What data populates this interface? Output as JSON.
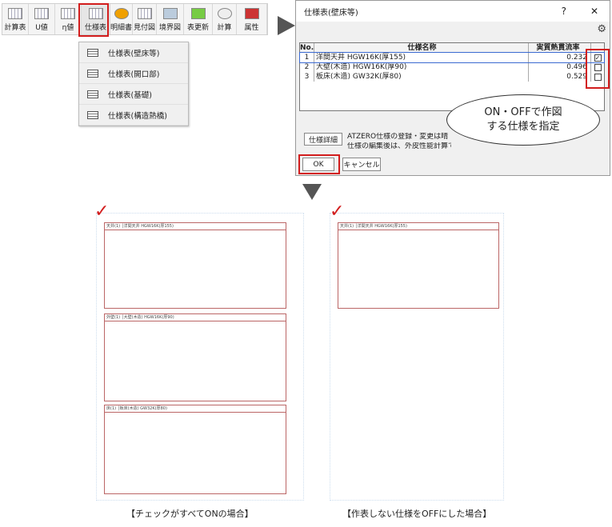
{
  "ribbon": {
    "items": [
      "計算表",
      "U値",
      "η値",
      "仕様表",
      "明細書",
      "見付図",
      "境界図",
      "表更新",
      "計算",
      "属性"
    ]
  },
  "menu": {
    "items": [
      "仕様表(壁床等)",
      "仕様表(開口部)",
      "仕様表(基礎)",
      "仕様表(構造熱橋)"
    ]
  },
  "dialog": {
    "title": "仕様表(壁床等)",
    "help": "?",
    "close": "✕",
    "headers": {
      "no": "No.",
      "name": "仕様名称",
      "value": "実質熱貫流率"
    },
    "rows": [
      {
        "no": "1",
        "name": "洋間天井 HGW16K(厚155)",
        "value": "0.232",
        "checked": true
      },
      {
        "no": "2",
        "name": "大壁(木造) HGW16K(厚90)",
        "value": "0.496",
        "checked": false
      },
      {
        "no": "3",
        "name": "板床(木造) GW32K(厚80)",
        "value": "0.529",
        "checked": false
      }
    ],
    "spec_detail": "仕様詳細",
    "note1": "ATZERO仕様の登録・変更は晴",
    "note2": "仕様の編集後は、外皮性能計算で計算",
    "ok": "OK",
    "cancel": "キャンセル"
  },
  "callout": {
    "line1": "ON・OFFで作図",
    "line2": "する仕様を指定"
  },
  "captions": {
    "left": "【チェックがすべてONの場合】",
    "right": "【作表しない仕様をOFFにした場合】"
  },
  "sheet_titles": {
    "a": "天井(1) │洋間天井 HGW16K(厚155)",
    "b": "外壁(1) │大壁(木造) HGW16K(厚90)",
    "c": "床(1) │板床(木造) GW32K(厚80)"
  },
  "colors": {
    "accent": "#d21d1d"
  }
}
